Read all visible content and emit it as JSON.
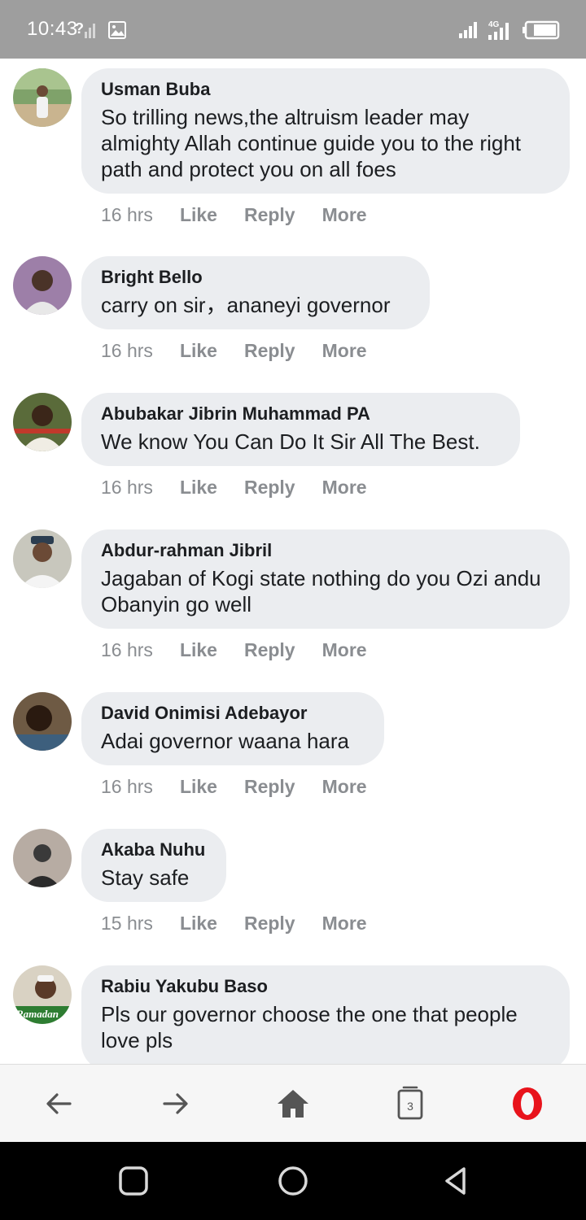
{
  "status_bar": {
    "time": "10:43",
    "left_icons": [
      "signal-question-icon",
      "image-icon"
    ],
    "right_icons": [
      "signal-icon",
      "4g-signal-icon",
      "battery-icon"
    ],
    "network_label": "4G"
  },
  "comments": [
    {
      "author": "Usman Buba",
      "text": "So trilling news,the altruism leader may almighty Allah continue guide you to the right path and protect you on all foes",
      "time": "16 hrs",
      "like": "Like",
      "reply": "Reply",
      "more": "More"
    },
    {
      "author": "Bright Bello",
      "text": "carry on sir，ananeyi governor",
      "time": "16 hrs",
      "like": "Like",
      "reply": "Reply",
      "more": "More"
    },
    {
      "author": "Abubakar Jibrin Muhammad PA",
      "text": "We know You Can Do It Sir All The Best.",
      "time": "16 hrs",
      "like": "Like",
      "reply": "Reply",
      "more": "More"
    },
    {
      "author": "Abdur-rahman Jibril",
      "text": "Jagaban of Kogi state nothing do you Ozi andu Obanyin go well",
      "time": "16 hrs",
      "like": "Like",
      "reply": "Reply",
      "more": "More"
    },
    {
      "author": "David Onimisi Adebayor",
      "text": "Adai governor waana hara",
      "time": "16 hrs",
      "like": "Like",
      "reply": "Reply",
      "more": "More"
    },
    {
      "author": "Akaba Nuhu",
      "text": "Stay safe",
      "time": "15 hrs",
      "like": "Like",
      "reply": "Reply",
      "more": "More"
    },
    {
      "author": "Rabiu Yakubu Baso",
      "text": "Pls our governor choose the one that people love pls",
      "avatar_text": "Ramadan"
    }
  ],
  "toolbar": {
    "tab_count": "3",
    "icons": [
      "back-arrow-icon",
      "forward-arrow-icon",
      "home-icon",
      "tabs-icon",
      "opera-logo-icon"
    ],
    "accent": "#e8131b"
  },
  "nav_bar": {
    "icons": [
      "recents-square-icon",
      "home-circle-icon",
      "back-triangle-icon"
    ]
  }
}
